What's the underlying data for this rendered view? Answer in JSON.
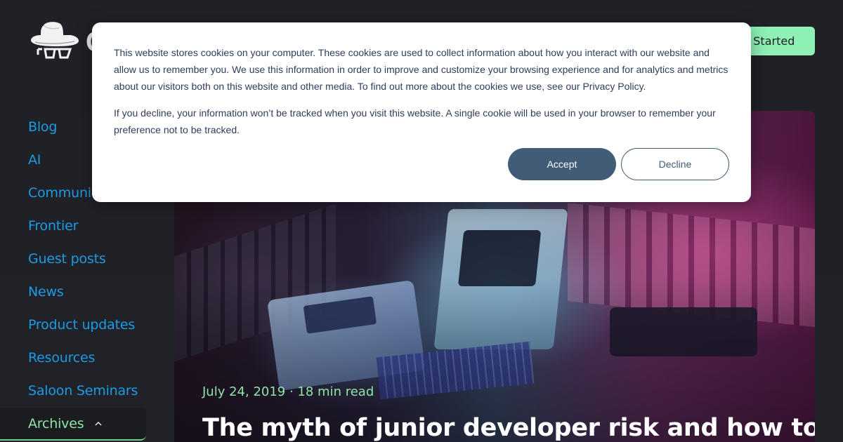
{
  "header": {
    "logo_alt": "Gunslinger hat-and-glasses logo",
    "logo_word": "G",
    "cta_label": "Get Started"
  },
  "colors": {
    "background": "#202126",
    "nav_link": "#1a9be6",
    "accent_green": "#8ef0b4",
    "active_nav_text": "#8fe3a6",
    "cookie_button": "#425b76"
  },
  "sidebar": {
    "items": [
      {
        "label": "Blog"
      },
      {
        "label": "AI"
      },
      {
        "label": "Communication"
      },
      {
        "label": "Frontier"
      },
      {
        "label": "Guest posts"
      },
      {
        "label": "News"
      },
      {
        "label": "Product updates"
      },
      {
        "label": "Resources"
      },
      {
        "label": "Saloon Seminars"
      }
    ],
    "archives": {
      "label": "Archives",
      "icon": "chevron-up-icon",
      "expanded": true
    }
  },
  "hero": {
    "meta": "July 24, 2019 · 18 min read",
    "date": "July 24, 2019",
    "read_time": "18 min read",
    "title": "The myth of junior developer risk and how to"
  },
  "cookie_banner": {
    "paragraph_1": "This website stores cookies on your computer. These cookies are used to collect information about how you interact with our website and allow us to remember you. We use this information in order to improve and customize your browsing experience and for analytics and metrics about our visitors both on this website and other media. To find out more about the cookies we use, see our Privacy Policy.",
    "paragraph_2": "If you decline, your information won’t be tracked when you visit this website. A single cookie will be used in your browser to remember your preference not to be tracked.",
    "accept_label": "Accept",
    "decline_label": "Decline"
  }
}
